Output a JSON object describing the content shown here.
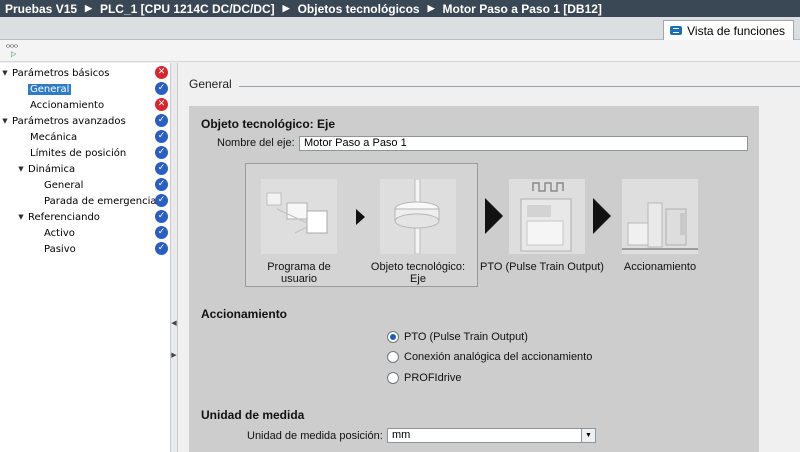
{
  "breadcrumb": [
    "Pruebas V15",
    "PLC_1 [CPU 1214C DC/DC/DC]",
    "Objetos tecnológicos",
    "Motor Paso a Paso 1 [DB12]"
  ],
  "function_view_tab": "Vista de funciones",
  "nav": {
    "items": [
      {
        "label": "Parámetros básicos",
        "status": "error"
      },
      {
        "label": "General",
        "status": "ok"
      },
      {
        "label": "Accionamiento",
        "status": "error"
      },
      {
        "label": "Parámetros avanzados",
        "status": "ok"
      },
      {
        "label": "Mecánica",
        "status": "ok"
      },
      {
        "label": "Límites de posición",
        "status": "ok"
      },
      {
        "label": "Dinámica",
        "status": "ok"
      },
      {
        "label": "General",
        "status": "ok"
      },
      {
        "label": "Parada de emergencia",
        "status": "ok"
      },
      {
        "label": "Referenciando",
        "status": "ok"
      },
      {
        "label": "Activo",
        "status": "ok"
      },
      {
        "label": "Pasivo",
        "status": "ok"
      }
    ]
  },
  "section": {
    "title": "General"
  },
  "object": {
    "heading": "Objeto tecnológico: Eje",
    "name_label": "Nombre del eje:",
    "name_value": "Motor Paso a Paso 1"
  },
  "diagram": {
    "program_caption_1": "Programa de",
    "program_caption_2": "usuario",
    "tech_caption_1": "Objeto tecnológico:",
    "tech_caption_2": "Eje",
    "pto_caption": "PTO (Pulse Train Output)",
    "drive_caption": "Accionamiento"
  },
  "drive": {
    "heading": "Accionamiento",
    "options": [
      {
        "label": "PTO (Pulse Train Output)",
        "selected": true
      },
      {
        "label": "Conexión analógica del accionamiento",
        "selected": false
      },
      {
        "label": "PROFIdrive",
        "selected": false
      }
    ]
  },
  "units": {
    "heading": "Unidad de medida",
    "position_label": "Unidad de medida posición:",
    "position_value": "mm"
  },
  "colors": {
    "ok": "#2a5fc1",
    "error": "#d8262e",
    "selection": "#2f7cc6"
  }
}
